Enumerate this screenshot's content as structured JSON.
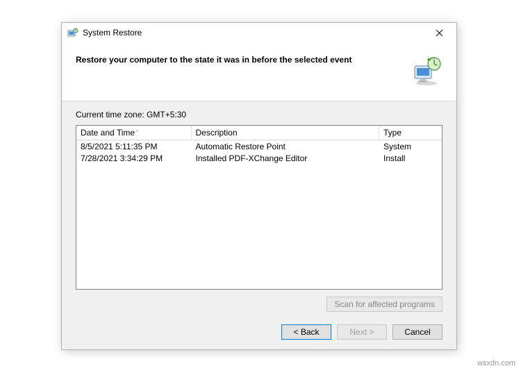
{
  "titlebar": {
    "title": "System Restore"
  },
  "header": {
    "heading": "Restore your computer to the state it was in before the selected event"
  },
  "content": {
    "timezone_label": "Current time zone: GMT+5:30",
    "columns": {
      "date": "Date and Time",
      "desc": "Description",
      "type": "Type"
    },
    "rows": [
      {
        "date": "8/5/2021 5:11:35 PM",
        "desc": "Automatic Restore Point",
        "type": "System"
      },
      {
        "date": "7/28/2021 3:34:29 PM",
        "desc": "Installed PDF-XChange Editor",
        "type": "Install"
      }
    ],
    "scan_button": "Scan for affected programs"
  },
  "footer": {
    "back": "< Back",
    "next": "Next >",
    "cancel": "Cancel"
  },
  "watermark": "wsxdn.com"
}
